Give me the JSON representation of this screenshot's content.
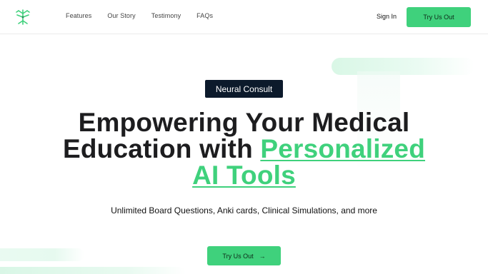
{
  "header": {
    "nav": [
      "Features",
      "Our Story",
      "Testimony",
      "FAQs"
    ],
    "sign_in": "Sign In",
    "cta": "Try Us Out"
  },
  "hero": {
    "badge": "Neural Consult",
    "headline_part1": "Empowering Your Medical",
    "headline_part2": "Education with ",
    "headline_highlight_1": "Personalized",
    "headline_highlight_2": "AI Tools",
    "subtitle": "Unlimited Board Questions, Anki cards, Clinical Simulations, and more",
    "cta": "Try Us Out",
    "cta_arrow": "→"
  },
  "colors": {
    "accent": "#3fd17c",
    "badge_bg": "#0c1a2b",
    "text": "#1d1d1f"
  },
  "icons": {
    "logo": "branching-molecule-logo-icon",
    "cta_arrow": "arrow-right-icon"
  }
}
